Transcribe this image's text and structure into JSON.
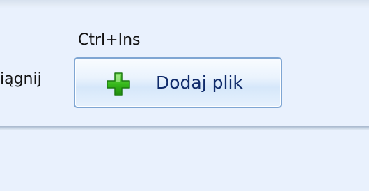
{
  "toolbar": {
    "truncated_left_label": "iągnij",
    "shortcut": "Ctrl+Ins",
    "add_file_label": "Dodaj plik"
  },
  "icons": {
    "add": "plus-icon"
  },
  "colors": {
    "background": "#e9f1fd",
    "button_border": "#7fa6d3",
    "button_text": "#0f2a6a",
    "plus_green": "#33b518"
  }
}
